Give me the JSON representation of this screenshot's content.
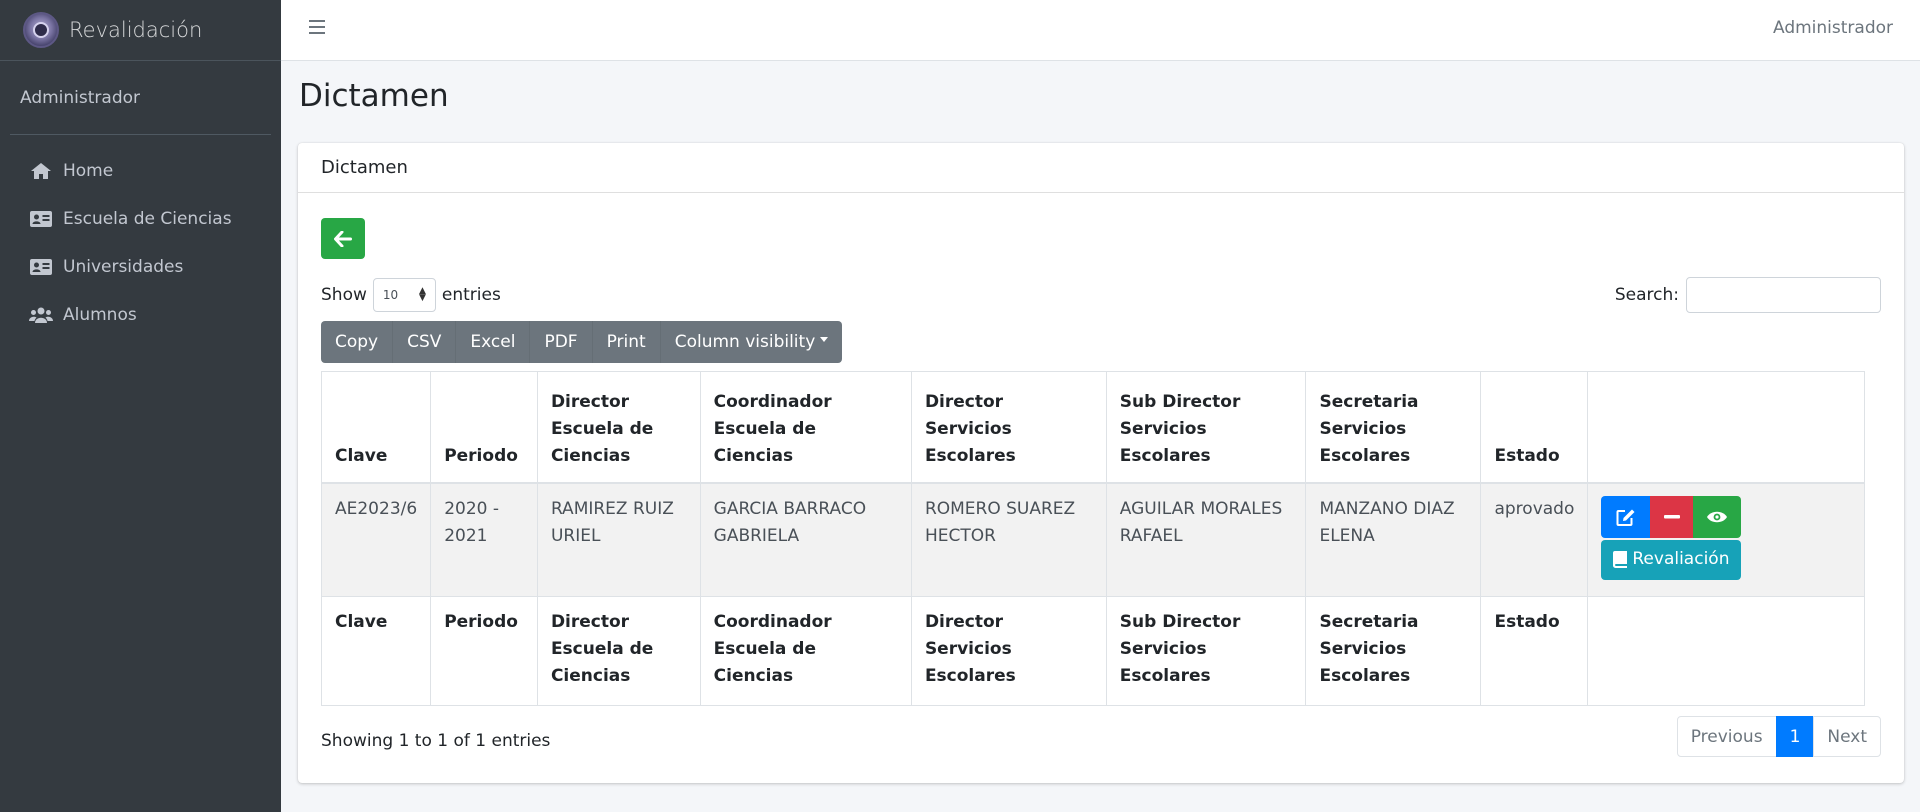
{
  "sidebar": {
    "brand": "Revalidación",
    "user": "Administrador",
    "items": [
      {
        "label": "Home",
        "icon": "home-icon"
      },
      {
        "label": "Escuela de Ciencias",
        "icon": "id-card-icon"
      },
      {
        "label": "Universidades",
        "icon": "id-card-icon"
      },
      {
        "label": "Alumnos",
        "icon": "users-icon"
      }
    ]
  },
  "topbar": {
    "user": "Administrador"
  },
  "page": {
    "title": "Dictamen"
  },
  "card": {
    "title": "Dictamen"
  },
  "length": {
    "show": "Show",
    "value": "10",
    "entries": "entries"
  },
  "search": {
    "label": "Search:",
    "value": ""
  },
  "export_buttons": [
    "Copy",
    "CSV",
    "Excel",
    "PDF",
    "Print",
    "Column visibility"
  ],
  "table": {
    "headers": [
      [
        "Clave"
      ],
      [
        "Periodo"
      ],
      [
        "Director",
        "Escuela de",
        "Ciencias"
      ],
      [
        "Coordinador",
        "Escuela de Ciencias"
      ],
      [
        "Director",
        "Servicios Escolares"
      ],
      [
        "Sub Director",
        "Servicios Escolares"
      ],
      [
        "Secretaria",
        "Servicios",
        "Escolares"
      ],
      [
        "Estado"
      ]
    ],
    "rows": [
      {
        "cells": [
          [
            "AE2023/6"
          ],
          [
            "2020 -",
            "2021"
          ],
          [
            "RAMIREZ RUIZ",
            "URIEL"
          ],
          [
            "GARCIA BARRACO",
            "GABRIELA"
          ],
          [
            "ROMERO SUAREZ",
            "HECTOR"
          ],
          [
            "AGUILAR MORALES",
            "RAFAEL"
          ],
          [
            "MANZANO DIAZ",
            "ELENA"
          ],
          [
            "aprovado"
          ]
        ],
        "revaliacion_label": "Revaliación"
      }
    ]
  },
  "info": "Showing 1 to 1 of 1 entries",
  "pagination": {
    "previous": "Previous",
    "current": "1",
    "next": "Next"
  },
  "colors": {
    "sidebar": "#343a40",
    "primary": "#007bff",
    "success": "#28a745",
    "danger": "#dc3545",
    "info": "#17a2b8",
    "secondary": "#6c757d"
  }
}
